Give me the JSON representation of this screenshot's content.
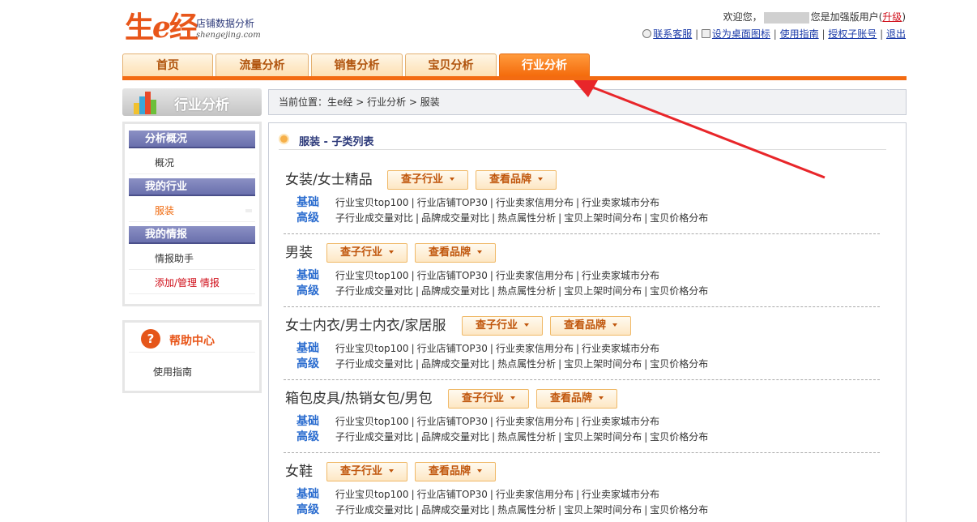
{
  "brand": {
    "name_prefix": "生",
    "name_e": "e",
    "name_suffix": "经",
    "subtitle": "店铺数据分析",
    "url": "shengejing.com",
    "color": "#e8561a"
  },
  "welcome": {
    "prefix": "欢迎您，",
    "suffix": "您是加强版用户",
    "upgrade_open": "(",
    "upgrade": "升级",
    "upgrade_close": ")"
  },
  "top_links": {
    "contact": "联系客服",
    "desktop": "设为桌面图标",
    "guide": "使用指南",
    "subaccount": "授权子账号",
    "logout": "退出",
    "icon_contact": "headset-icon",
    "icon_desktop": "shortcut-icon"
  },
  "tabs": [
    {
      "label": "首页",
      "active": false
    },
    {
      "label": "流量分析",
      "active": false
    },
    {
      "label": "销售分析",
      "active": false
    },
    {
      "label": "宝贝分析",
      "active": false
    },
    {
      "label": "行业分析",
      "active": true
    }
  ],
  "sidebar": {
    "title": "行业分析",
    "groups": [
      {
        "title": "分析概况",
        "items": [
          {
            "label": "概况"
          }
        ]
      },
      {
        "title": "我的行业",
        "items": [
          {
            "label": "服装"
          }
        ]
      },
      {
        "title": "我的情报",
        "items": [
          {
            "label": "情报助手"
          },
          {
            "label": "添加/管理 情报"
          }
        ]
      }
    ]
  },
  "help": {
    "title": "帮助中心",
    "icon_glyph": "?",
    "item": "使用指南"
  },
  "breadcrumb": {
    "text": "当前位置：生e经 > 行业分析 > 服装"
  },
  "main": {
    "title": "服装 - 子类列表",
    "dropdown_industry": "查子行业",
    "dropdown_brand": "查看品牌",
    "basic_label": "基础",
    "advanced_label": "高级",
    "basic_links": [
      "行业宝贝top100",
      "行业店铺TOP30",
      "行业卖家信用分布",
      "行业卖家城市分布"
    ],
    "advanced_links": [
      "子行业成交量对比",
      "品牌成交量对比",
      "热点属性分析",
      "宝贝上架时间分布",
      "宝贝价格分布"
    ],
    "categories": [
      {
        "name": "女装/女士精品"
      },
      {
        "name": "男装"
      },
      {
        "name": "女士内衣/男士内衣/家居服"
      },
      {
        "name": "箱包皮具/热销女包/男包"
      },
      {
        "name": "女鞋"
      }
    ]
  },
  "colors": {
    "accent": "#f36b12",
    "link_blue": "#1a3aa8",
    "label_blue": "#2a6ccf",
    "annotation_red": "#e8262a"
  }
}
